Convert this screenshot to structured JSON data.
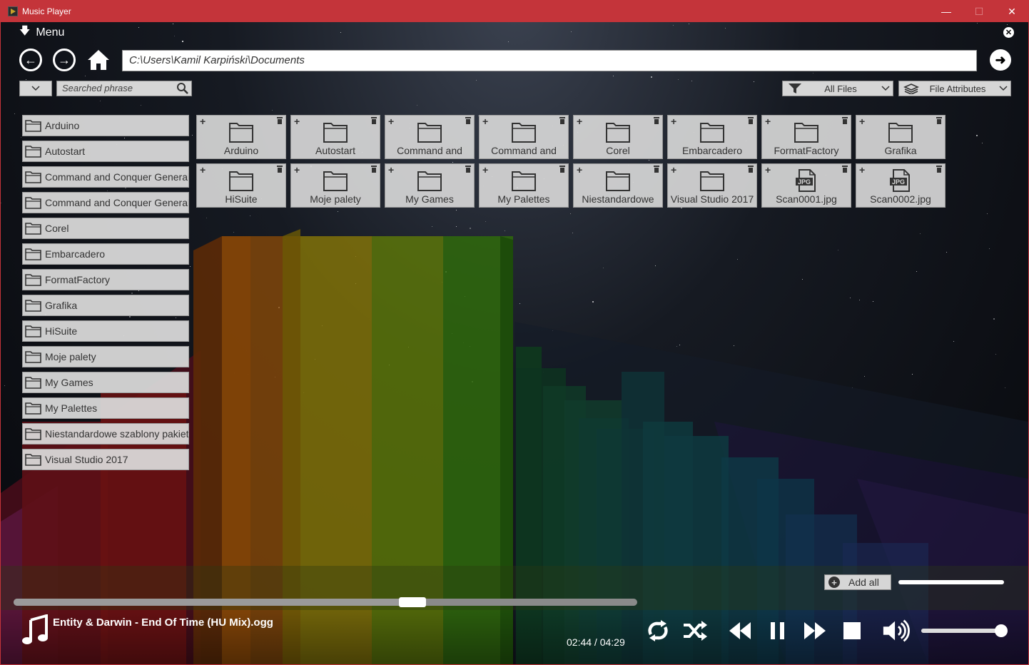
{
  "window": {
    "title": "Music Player",
    "minimize_glyph": "—",
    "maximize_glyph": "☐",
    "close_glyph": "✕"
  },
  "menu": {
    "label": "Menu",
    "arrow_glyph": "🡇"
  },
  "navigation": {
    "back_glyph": "←",
    "forward_glyph": "→",
    "path": "C:\\Users\\Kamil Karpiński\\Documents",
    "go_glyph": "➜"
  },
  "search": {
    "placeholder": "Searched phrase",
    "dropdown_glyph": "⌄"
  },
  "filters": {
    "file_type": "All Files",
    "attributes": "File Attributes",
    "chevron": "⌄"
  },
  "sidebar": {
    "items": [
      {
        "label": "Arduino"
      },
      {
        "label": "Autostart"
      },
      {
        "label": "Command and Conquer Generals"
      },
      {
        "label": "Command and Conquer Generals"
      },
      {
        "label": "Corel"
      },
      {
        "label": "Embarcadero"
      },
      {
        "label": "FormatFactory"
      },
      {
        "label": "Grafika"
      },
      {
        "label": "HiSuite"
      },
      {
        "label": "Moje palety"
      },
      {
        "label": "My Games"
      },
      {
        "label": "My Palettes"
      },
      {
        "label": "Niestandardowe szablony pakietu"
      },
      {
        "label": "Visual Studio 2017"
      }
    ]
  },
  "grid": {
    "tiles": [
      {
        "label": "Arduino",
        "type": "folder"
      },
      {
        "label": "Autostart",
        "type": "folder"
      },
      {
        "label": "Command and",
        "type": "folder"
      },
      {
        "label": "Command and",
        "type": "folder"
      },
      {
        "label": "Corel",
        "type": "folder"
      },
      {
        "label": "Embarcadero",
        "type": "folder"
      },
      {
        "label": "FormatFactory",
        "type": "folder"
      },
      {
        "label": "Grafika",
        "type": "folder"
      },
      {
        "label": "HiSuite",
        "type": "folder"
      },
      {
        "label": "Moje palety",
        "type": "folder"
      },
      {
        "label": "My Games",
        "type": "folder"
      },
      {
        "label": "My Palettes",
        "type": "folder"
      },
      {
        "label": "Niestandardowe",
        "type": "folder"
      },
      {
        "label": "Visual Studio 2017",
        "type": "folder"
      },
      {
        "label": "Scan0001.jpg",
        "type": "jpg"
      },
      {
        "label": "Scan0002.jpg",
        "type": "jpg"
      }
    ],
    "plus_glyph": "+",
    "jpg_badge": "JPG"
  },
  "playlist": {
    "add_all_label": "Add all",
    "plus_glyph": "+"
  },
  "player": {
    "track": "Entity & Darwin - End Of Time (HU Mix).ogg",
    "time": "02:44 / 04:29",
    "progress": 0.64,
    "volume": 0.95,
    "playlist_scroll": 1.0
  },
  "colors": {
    "titlebar": "#c4343a",
    "panel": "#d6d6d6",
    "text_dark": "#333333"
  }
}
